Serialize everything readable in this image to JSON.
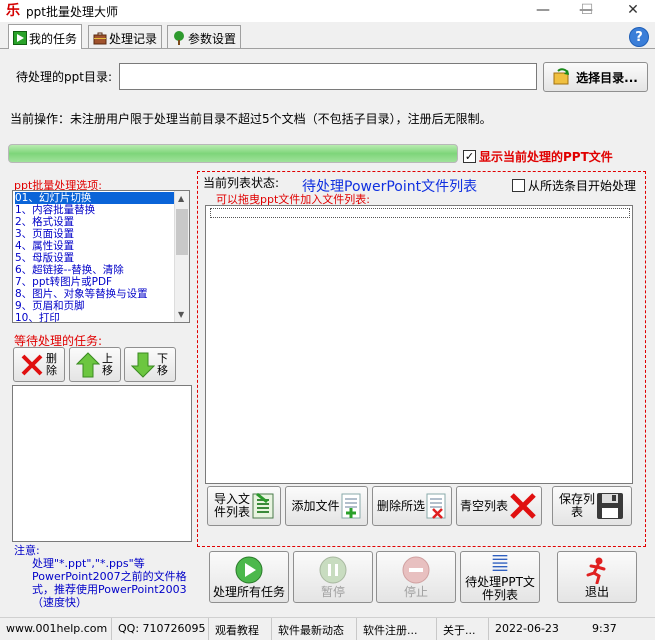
{
  "window": {
    "title": "ppt批量处理大师",
    "logo": "乐",
    "minimize": "—",
    "maximize": "☐",
    "close": "✕"
  },
  "tabs": [
    {
      "label": "我的任务",
      "icon": "play-icon",
      "active": true
    },
    {
      "label": "处理记录",
      "icon": "briefcase-icon"
    },
    {
      "label": "参数设置",
      "icon": "tree-icon"
    }
  ],
  "help": "?",
  "directory": {
    "label": "待处理的ppt目录:",
    "value": "",
    "button": "选择目录..."
  },
  "current_operation": "当前操作：未注册用户限于处理当前目录不超过5个文档（不包括子目录），注册后无限制。",
  "progress": {
    "percent": 100
  },
  "show_current": {
    "label": "显示当前处理的PPT文件",
    "checked": true
  },
  "options": {
    "label": "ppt批量处理选项:",
    "items": [
      "01、幻灯片切换",
      "1、内容批量替换",
      "2、格式设置",
      "3、页面设置",
      "4、属性设置",
      "5、母版设置",
      "6、超链接--替换、清除",
      "7、ppt转图片或PDF",
      "8、图片、对象等替换与设置",
      "9、页眉和页脚",
      "10、打印"
    ],
    "selected_index": 0
  },
  "waiting": {
    "label": "等待处理的任务:",
    "delete": "删除",
    "up": "上移",
    "down": "下移"
  },
  "note": {
    "title": "注意:",
    "text": "处理\"*.ppt\",\"*.pps\"等PowerPoint2007之前的文件格式，推荐使用PowerPoint2003（速度快）"
  },
  "right": {
    "status_label": "当前列表状态:",
    "title": "待处理PowerPoint文件列表",
    "from_selected": {
      "label": "从所选条目开始处理",
      "checked": false
    },
    "drag_hint": "可以拖曳ppt文件加入文件列表:",
    "buttons": {
      "import": "导入文件列表",
      "add": "添加文件",
      "delete_selected": "删除所选",
      "clear": "青空列表",
      "save": "保存列表"
    }
  },
  "actions": {
    "process_all": "处理所有任务",
    "pause": "暂停",
    "stop": "停止",
    "pending_list": "待处理PPT文件列表",
    "exit": "退出"
  },
  "statusbar": [
    "www.001help.com",
    "QQ: 710726095",
    "观看教程",
    "软件最新动态",
    "软件注册...",
    "关于...",
    "2022-06-23",
    "9:37"
  ],
  "colors": {
    "red_label": "#e00000",
    "blue_text": "#0000c8",
    "progress_green": "#7ed57a"
  }
}
